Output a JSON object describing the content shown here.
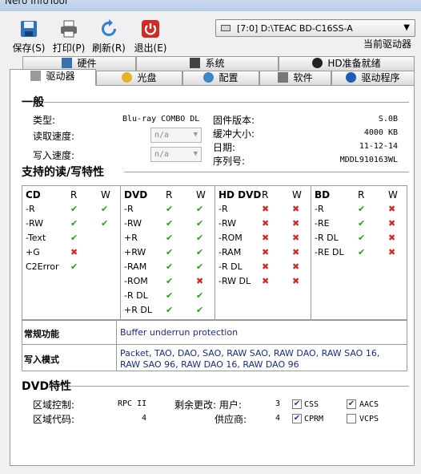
{
  "window": {
    "title": "Nero InfoTool"
  },
  "toolbar": {
    "save": "保存(S)",
    "print": "打印(P)",
    "refresh": "刷新(R)",
    "exit": "退出(E)"
  },
  "device": {
    "value": "[7:0]  D:\\TEAC     BD-C16SS-A",
    "caption": "当前驱动器"
  },
  "tabs_row1": [
    {
      "label": "硬件",
      "icon": "hardware-icon"
    },
    {
      "label": "系统",
      "icon": "system-icon"
    },
    {
      "label": "HD准备就绪",
      "icon": "hd-ready-icon"
    }
  ],
  "tabs_row2": [
    {
      "label": "驱动器",
      "icon": "drive-icon"
    },
    {
      "label": "光盘",
      "icon": "disc-icon"
    },
    {
      "label": "配置",
      "icon": "config-icon"
    },
    {
      "label": "软件",
      "icon": "software-icon"
    },
    {
      "label": "驱动程序",
      "icon": "info-icon"
    }
  ],
  "general": {
    "heading": "一般",
    "type_label": "类型:",
    "type_value": "Blu-ray COMBO DL",
    "read_label": "读取速度:",
    "read_value": "n/a",
    "write_label": "写入速度:",
    "write_value": "n/a",
    "firmware_label": "固件版本:",
    "firmware_value": "S.0B",
    "buffer_label": "缓冲大小:",
    "buffer_value": "4000 KB",
    "date_label": "日期:",
    "date_value": "11-12-14",
    "serial_label": "序列号:",
    "serial_value": "MDDL910163WL"
  },
  "rw": {
    "heading": "支持的读/写特性",
    "col_r": "R",
    "col_w": "W",
    "groups": [
      {
        "name": "CD",
        "rows": [
          {
            "label": "-R",
            "r": "yes",
            "w": "yes"
          },
          {
            "label": "-RW",
            "r": "yes",
            "w": "yes"
          },
          {
            "label": "-Text",
            "r": "yes",
            "w": ""
          },
          {
            "label": "+G",
            "r": "no",
            "w": ""
          },
          {
            "label": "C2Error",
            "r": "yes",
            "w": ""
          }
        ]
      },
      {
        "name": "DVD",
        "rows": [
          {
            "label": "-R",
            "r": "yes",
            "w": "yes"
          },
          {
            "label": "-RW",
            "r": "yes",
            "w": "yes"
          },
          {
            "label": "+R",
            "r": "yes",
            "w": "yes"
          },
          {
            "label": "+RW",
            "r": "yes",
            "w": "yes"
          },
          {
            "label": "-RAM",
            "r": "yes",
            "w": "yes"
          },
          {
            "label": "-ROM",
            "r": "yes",
            "w": "no"
          },
          {
            "label": "-R DL",
            "r": "yes",
            "w": "yes"
          },
          {
            "label": "+R DL",
            "r": "yes",
            "w": "yes"
          }
        ]
      },
      {
        "name": "HD DVD",
        "rows": [
          {
            "label": "-R",
            "r": "no",
            "w": "no"
          },
          {
            "label": "-RW",
            "r": "no",
            "w": "no"
          },
          {
            "label": "-ROM",
            "r": "no",
            "w": "no"
          },
          {
            "label": "-RAM",
            "r": "no",
            "w": "no"
          },
          {
            "label": "-R DL",
            "r": "no",
            "w": "no"
          },
          {
            "label": "-RW DL",
            "r": "no",
            "w": "no"
          }
        ]
      },
      {
        "name": "BD",
        "rows": [
          {
            "label": "-R",
            "r": "yes",
            "w": "no"
          },
          {
            "label": "-RE",
            "r": "yes",
            "w": "no"
          },
          {
            "label": "-R DL",
            "r": "yes",
            "w": "no"
          },
          {
            "label": "-RE DL",
            "r": "yes",
            "w": "no"
          }
        ]
      }
    ]
  },
  "features": {
    "common_label": "常规功能",
    "common_value": "Buffer underrun protection",
    "write_mode_label": "写入模式",
    "write_mode_value": "Packet, TAO, DAO, SAO, RAW SAO, RAW DAO, RAW SAO 16, RAW SAO 96, RAW DAO 16, RAW DAO 96"
  },
  "dvd": {
    "heading": "DVD特性",
    "region_control_label": "区域控制:",
    "region_control_value": "RPC II",
    "changes_label": "剩余更改: 用户:",
    "changes_value": "3",
    "region_code_label": "区域代码:",
    "region_code_value": "4",
    "vendor_label": "供应商:",
    "vendor_value": "4",
    "css": "CSS",
    "cprm": "CPRM",
    "aacs": "AACS",
    "vcps": "VCPS",
    "css_checked": true,
    "cprm_checked": true,
    "aacs_checked": true,
    "vcps_checked": false
  },
  "colors": {
    "ok": "#2a9d1f",
    "no": "#d9261c",
    "link": "#1a2b8a"
  }
}
